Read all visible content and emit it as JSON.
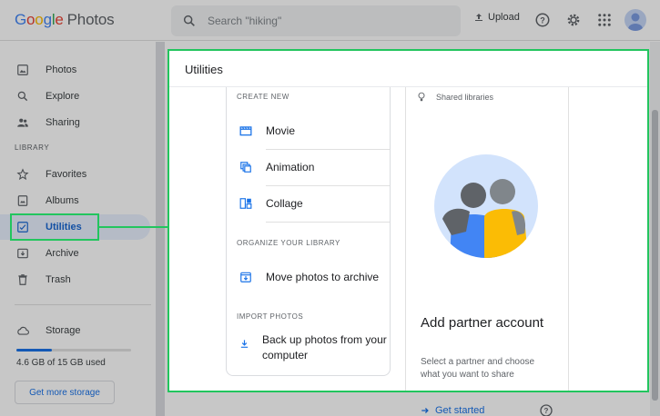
{
  "header": {
    "logo_google": [
      "G",
      "o",
      "o",
      "g",
      "l",
      "e"
    ],
    "logo_product": "Photos",
    "search_placeholder": "Search \"hiking\"",
    "upload_label": "Upload"
  },
  "sidebar": {
    "items": [
      {
        "label": "Photos",
        "icon": "photo-icon"
      },
      {
        "label": "Explore",
        "icon": "search-icon"
      },
      {
        "label": "Sharing",
        "icon": "people-icon"
      }
    ],
    "library_label": "LIBRARY",
    "library_items": [
      {
        "label": "Favorites",
        "icon": "star-icon"
      },
      {
        "label": "Albums",
        "icon": "album-icon"
      },
      {
        "label": "Utilities",
        "icon": "utilities-icon",
        "active": true
      },
      {
        "label": "Archive",
        "icon": "archive-icon"
      },
      {
        "label": "Trash",
        "icon": "trash-icon"
      }
    ],
    "storage": {
      "label": "Storage",
      "used_text": "4.6 GB of 15 GB used",
      "used_fraction": 0.31,
      "button": "Get more storage"
    }
  },
  "utilities": {
    "title": "Utilities",
    "create_new_label": "CREATE NEW",
    "create_items": [
      "Movie",
      "Animation",
      "Collage"
    ],
    "organize_label": "ORGANIZE YOUR LIBRARY",
    "organize_items": [
      "Move photos to archive"
    ],
    "import_label": "IMPORT PHOTOS",
    "import_items": [
      "Back up photos from your computer"
    ],
    "shared_label": "Shared libraries",
    "partner_title": "Add partner account",
    "partner_desc": "Select a partner and choose what you want to share",
    "get_started": "Get started"
  },
  "colors": {
    "accent": "#1a73e8",
    "highlight": "#22c55e"
  }
}
